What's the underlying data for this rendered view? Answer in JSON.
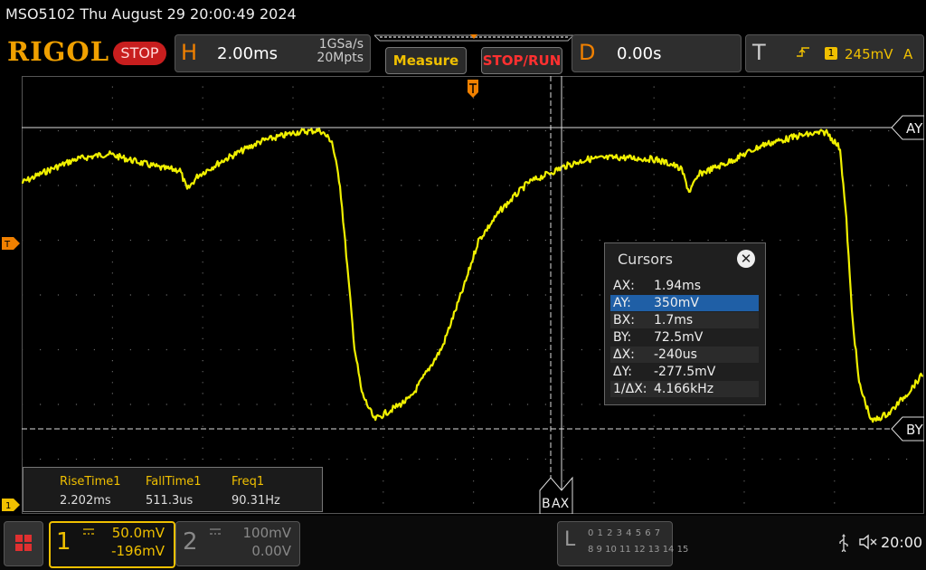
{
  "status_line": "MSO5102  Thu August 29 20:00:49 2024",
  "brand": "RIGOL",
  "run_state_badge": "STOP",
  "horizontal": {
    "letter": "H",
    "timebase": "2.00ms",
    "sample_rate": "1GSa/s",
    "memory_depth": "20Mpts"
  },
  "buttons": {
    "measure": "Measure",
    "stop_run": "STOP/RUN"
  },
  "delay": {
    "letter": "D",
    "value": "0.00s"
  },
  "trigger": {
    "letter": "T",
    "source": "1",
    "level": "245mV",
    "mode": "A"
  },
  "cursor_labels": {
    "ay": "AY",
    "by": "BY",
    "ax": "AX",
    "bx": "B"
  },
  "markers": {
    "trigger_level": "T",
    "ch1_ground": "1"
  },
  "cursors_panel": {
    "title": "Cursors",
    "close": "✕",
    "rows": [
      {
        "key": "AX:",
        "value": "1.94ms"
      },
      {
        "key": "AY:",
        "value": "350mV"
      },
      {
        "key": "BX:",
        "value": "1.7ms"
      },
      {
        "key": "BY:",
        "value": "72.5mV"
      },
      {
        "key": "ΔX:",
        "value": "-240us"
      },
      {
        "key": "ΔY:",
        "value": "-277.5mV"
      },
      {
        "key": "1/ΔX:",
        "value": "4.166kHz"
      }
    ]
  },
  "measurements": [
    {
      "name": "RiseTime1",
      "value": "2.202ms"
    },
    {
      "name": "FallTime1",
      "value": "511.3us"
    },
    {
      "name": "Freq1",
      "value": "90.31Hz"
    }
  ],
  "channels": [
    {
      "number": "1",
      "scale": "50.0mV",
      "offset": "-196mV",
      "coupling_icon": "dc-coupling-icon",
      "color": "#f0c000"
    },
    {
      "number": "2",
      "scale": "100mV",
      "offset": "0.00V",
      "coupling_icon": "dc-coupling-icon",
      "color": "#888888"
    }
  ],
  "logic": {
    "letter": "L",
    "row1": "0 1 2 3  4 5 6 7",
    "row2": "8 9 10 11 12 13 14 15"
  },
  "clock": "20:00",
  "icons": {
    "usb": "usb-icon",
    "speaker": "speaker-muted-icon",
    "menu": "menu-grid-icon"
  },
  "colors": {
    "trace": "#f0f000",
    "brand": "#f0a000",
    "stop": "#c81e1e",
    "highlight": "#1f5fa6"
  }
}
